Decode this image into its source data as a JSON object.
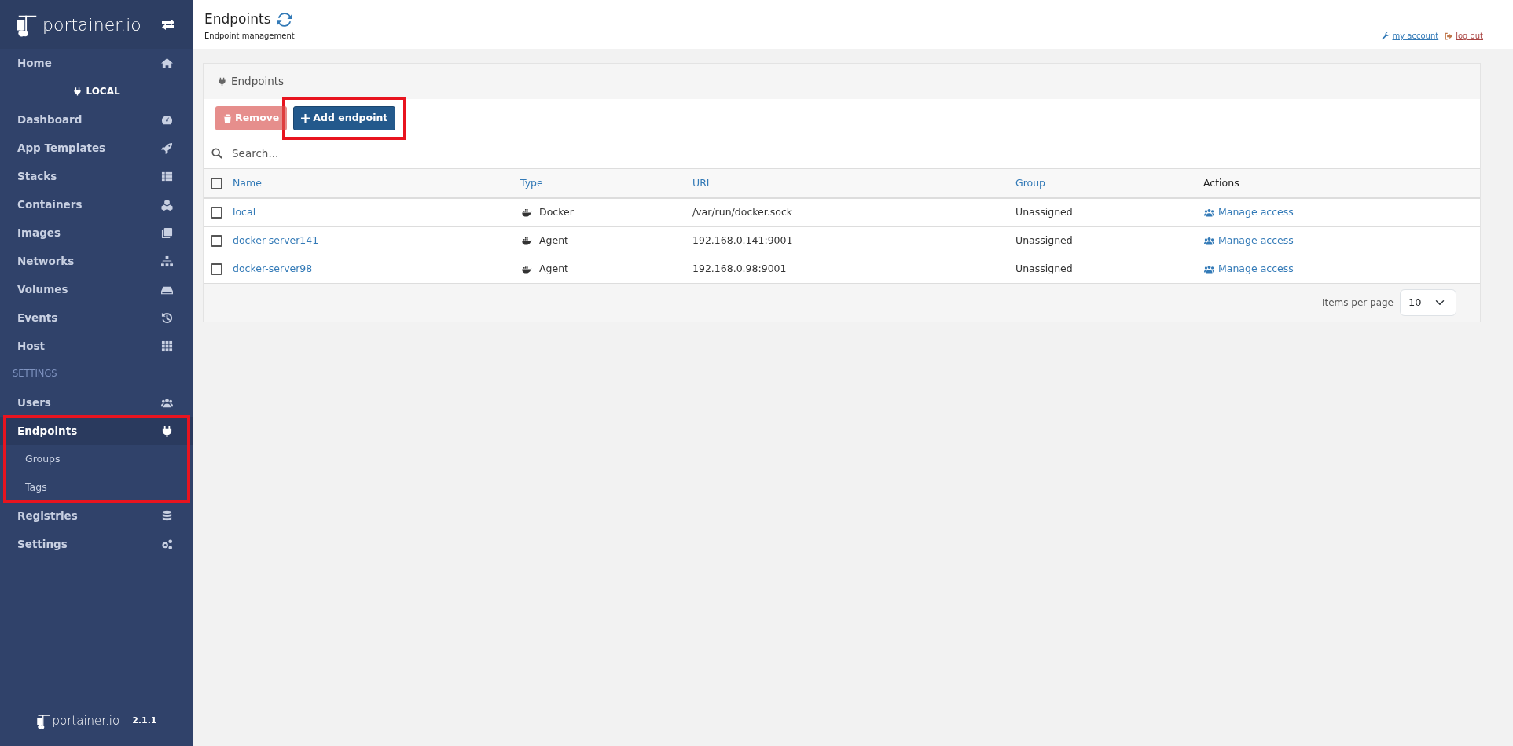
{
  "sidebar": {
    "logo": "portainer.io",
    "items": [
      {
        "kind": "item",
        "label": "Home",
        "selected": false,
        "highlighted": false
      },
      {
        "kind": "endpoint",
        "label": "LOCAL"
      },
      {
        "kind": "item",
        "label": "Dashboard",
        "selected": false,
        "highlighted": false
      },
      {
        "kind": "item",
        "label": "App Templates",
        "selected": false,
        "highlighted": false
      },
      {
        "kind": "item",
        "label": "Stacks",
        "selected": false,
        "highlighted": false
      },
      {
        "kind": "item",
        "label": "Containers",
        "selected": false,
        "highlighted": false
      },
      {
        "kind": "item",
        "label": "Images",
        "selected": false,
        "highlighted": false
      },
      {
        "kind": "item",
        "label": "Networks",
        "selected": false,
        "highlighted": false
      },
      {
        "kind": "item",
        "label": "Volumes",
        "selected": false,
        "highlighted": false
      },
      {
        "kind": "item",
        "label": "Events",
        "selected": false,
        "highlighted": false
      },
      {
        "kind": "item",
        "label": "Host",
        "selected": false,
        "highlighted": false
      },
      {
        "kind": "section",
        "label": "SETTINGS"
      },
      {
        "kind": "item",
        "label": "Users",
        "selected": false,
        "highlighted": false
      },
      {
        "kind": "item",
        "label": "Endpoints",
        "selected": true,
        "highlighted": true,
        "children": [
          {
            "label": "Groups"
          },
          {
            "label": "Tags"
          }
        ]
      },
      {
        "kind": "item",
        "label": "Registries",
        "selected": false,
        "highlighted": false
      },
      {
        "kind": "item",
        "label": "Settings",
        "selected": false,
        "highlighted": false
      }
    ],
    "footer": {
      "logo": "portainer.io",
      "version": "2.1.1"
    }
  },
  "header": {
    "title": "Endpoints",
    "subtitle": "Endpoint management",
    "links": [
      {
        "kind": "account",
        "label": "my account"
      },
      {
        "kind": "logout",
        "label": "log out"
      }
    ]
  },
  "widget": {
    "title": "Endpoints",
    "buttons": [
      {
        "kind": "remove",
        "label": "Remove",
        "disabled": true,
        "highlighted": false
      },
      {
        "kind": "add",
        "label": "Add endpoint",
        "disabled": false,
        "highlighted": true
      }
    ],
    "search": {
      "placeholder": "Search..."
    },
    "table": {
      "all_checked": false,
      "columns": [
        {
          "label": "Name",
          "sortable": true
        },
        {
          "label": "Type",
          "sortable": true
        },
        {
          "label": "URL",
          "sortable": true
        },
        {
          "label": "Group",
          "sortable": true
        },
        {
          "label": "Actions",
          "sortable": false
        }
      ],
      "rows": [
        {
          "checked": false,
          "name": "local",
          "type": "Docker",
          "url": "/var/run/docker.sock",
          "group": "Unassigned",
          "action": "Manage access"
        },
        {
          "checked": false,
          "name": "docker-server141",
          "type": "Agent",
          "url": "192.168.0.141:9001",
          "group": "Unassigned",
          "action": "Manage access"
        },
        {
          "checked": false,
          "name": "docker-server98",
          "type": "Agent",
          "url": "192.168.0.98:9001",
          "group": "Unassigned",
          "action": "Manage access"
        }
      ]
    },
    "pagination": {
      "label": "Items per page",
      "value": "10"
    }
  }
}
